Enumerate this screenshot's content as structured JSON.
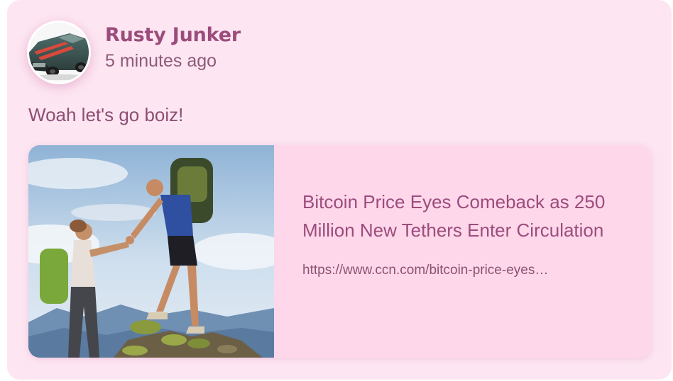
{
  "post": {
    "author_name": "Rusty Junker",
    "time_ago": "5 minutes ago",
    "text": "Woah let's go boiz!",
    "avatar_icon": "car-avatar-icon"
  },
  "link_preview": {
    "title": "Bitcoin Price Eyes Comeback as 250 Million New Tethers Enter Circulation",
    "url": "https://www.ccn.com/bitcoin-price-eyes…",
    "image_icon": "hikers-image"
  },
  "colors": {
    "card_background": "#fde6f2",
    "preview_background": "#ffd7ea",
    "accent": "#9b4c7c"
  }
}
